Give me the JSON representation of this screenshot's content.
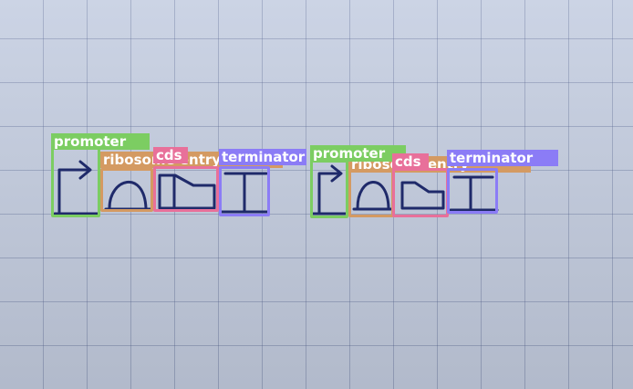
{
  "colors": {
    "promoter": "#7ccd62",
    "ribosome_entry": "#d49a62",
    "cds": "#e8709a",
    "terminator": "#8b7cf6",
    "ink": "#1f2a6a"
  },
  "detections": [
    {
      "label": "promoter",
      "class": "promoter"
    },
    {
      "label": "ribosome entry",
      "class": "ribosome_entry"
    },
    {
      "label": "cds",
      "class": "cds"
    },
    {
      "label": "terminator",
      "class": "terminator"
    },
    {
      "label": "promoter",
      "class": "promoter"
    },
    {
      "label": "ribosome entry",
      "class": "ribosome_entry"
    },
    {
      "label": "cds",
      "class": "cds"
    },
    {
      "label": "terminator",
      "class": "terminator"
    }
  ]
}
